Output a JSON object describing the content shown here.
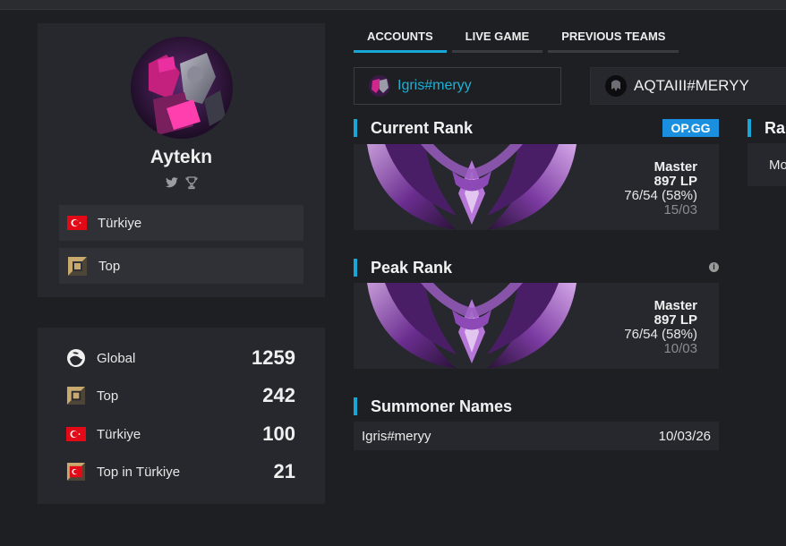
{
  "profile": {
    "name": "Aytekn",
    "rows": [
      {
        "label": "Türkiye",
        "icon": "turkey-flag-icon"
      },
      {
        "label": "Top",
        "icon": "top-lane-icon"
      }
    ],
    "social_icons": [
      "twitter-icon",
      "trophy-icon"
    ]
  },
  "rankings": [
    {
      "label": "Global",
      "value": "1259",
      "icon": "globe-icon"
    },
    {
      "label": "Top",
      "value": "242",
      "icon": "top-lane-icon"
    },
    {
      "label": "Türkiye",
      "value": "100",
      "icon": "turkey-flag-icon"
    },
    {
      "label": "Top in Türkiye",
      "value": "21",
      "icon": "top-turkey-icon"
    }
  ],
  "tabs": [
    {
      "label": "ACCOUNTS",
      "active": true
    },
    {
      "label": "LIVE GAME",
      "active": false
    },
    {
      "label": "PREVIOUS TEAMS",
      "active": false
    }
  ],
  "accounts": [
    {
      "name": "Igris#meryy",
      "selected": true
    },
    {
      "name": "AQTAIII#MERYY",
      "selected": false
    }
  ],
  "current_rank": {
    "heading": "Current Rank",
    "badge": "OP.GG",
    "tier": "Master",
    "lp": "897 LP",
    "record": "76/54 (58%)",
    "date": "15/03"
  },
  "peak_rank": {
    "heading": "Peak Rank",
    "info": "i",
    "tier": "Master",
    "lp": "897 LP",
    "record": "76/54 (58%)",
    "date": "10/03"
  },
  "summoner_names": {
    "heading": "Summoner Names",
    "rows": [
      {
        "name": "Igris#meryy",
        "date": "10/03/26"
      }
    ]
  },
  "edge_panel": {
    "heading": "Ra",
    "text": "Mo"
  },
  "colors": {
    "accent": "#17a7d7",
    "opgg": "#1a8fe0",
    "background": "#1d1f23",
    "card": "#26282d"
  }
}
